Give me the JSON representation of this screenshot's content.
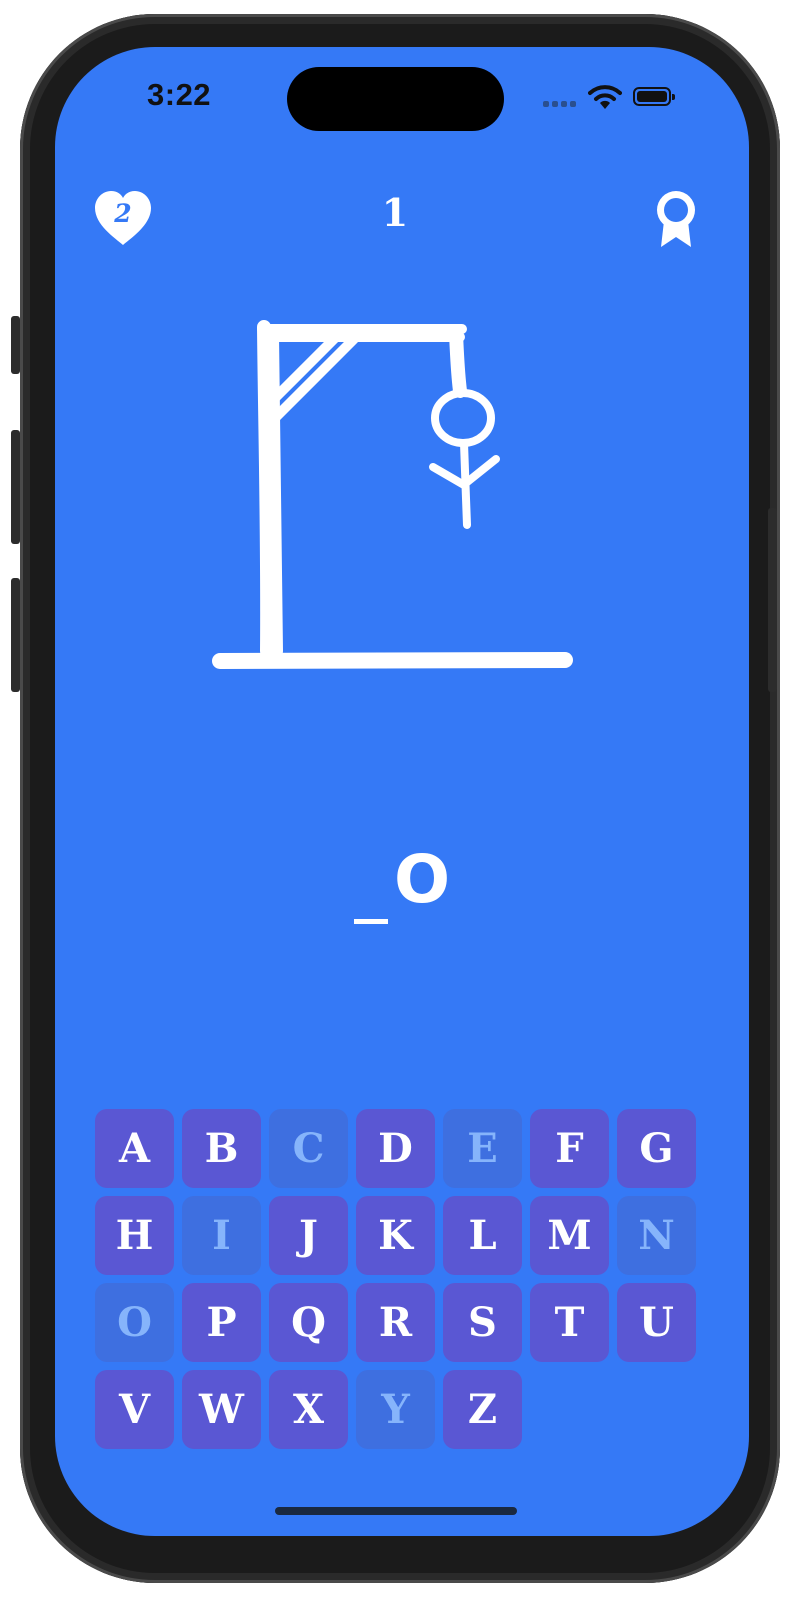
{
  "status_bar": {
    "time": "3:22"
  },
  "header": {
    "lives": "2",
    "score": "1"
  },
  "icons": {
    "lives": "heart-icon",
    "achievements": "award-ribbon-icon",
    "wifi": "wifi-icon",
    "battery": "battery-icon"
  },
  "word": {
    "slots": [
      "",
      "O"
    ]
  },
  "keyboard": {
    "keys": [
      {
        "letter": "A",
        "used": false
      },
      {
        "letter": "B",
        "used": false
      },
      {
        "letter": "C",
        "used": true
      },
      {
        "letter": "D",
        "used": false
      },
      {
        "letter": "E",
        "used": true
      },
      {
        "letter": "F",
        "used": false
      },
      {
        "letter": "G",
        "used": false
      },
      {
        "letter": "H",
        "used": false
      },
      {
        "letter": "I",
        "used": true
      },
      {
        "letter": "J",
        "used": false
      },
      {
        "letter": "K",
        "used": false
      },
      {
        "letter": "L",
        "used": false
      },
      {
        "letter": "M",
        "used": false
      },
      {
        "letter": "N",
        "used": true
      },
      {
        "letter": "O",
        "used": true
      },
      {
        "letter": "P",
        "used": false
      },
      {
        "letter": "Q",
        "used": false
      },
      {
        "letter": "R",
        "used": false
      },
      {
        "letter": "S",
        "used": false
      },
      {
        "letter": "T",
        "used": false
      },
      {
        "letter": "U",
        "used": false
      },
      {
        "letter": "V",
        "used": false
      },
      {
        "letter": "W",
        "used": false
      },
      {
        "letter": "X",
        "used": false
      },
      {
        "letter": "Y",
        "used": true
      },
      {
        "letter": "Z",
        "used": false
      }
    ]
  },
  "colors": {
    "background": "#3579F6",
    "key": "#5A57D3",
    "key_used": "#3E6FE0",
    "key_used_text": "#86B4FB",
    "ink": "#FFFFFF"
  }
}
